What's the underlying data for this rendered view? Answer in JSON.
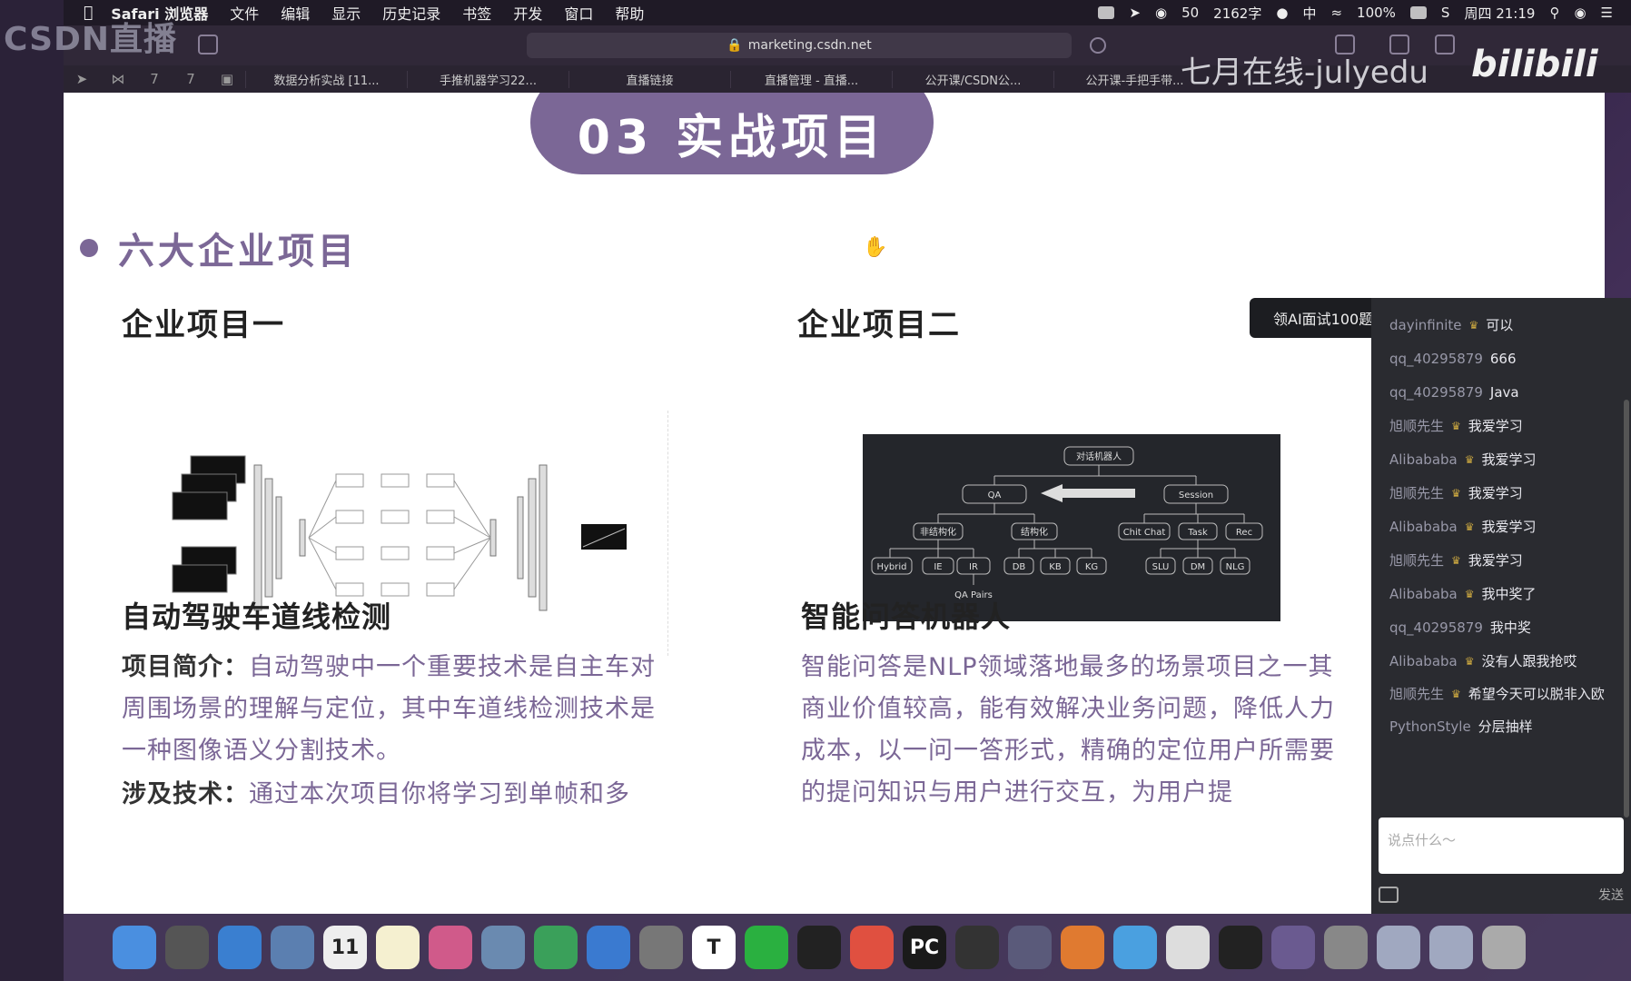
{
  "menubar": {
    "app": "Safari 浏览器",
    "items": [
      "文件",
      "编辑",
      "显示",
      "历史记录",
      "书签",
      "开发",
      "窗口",
      "帮助"
    ],
    "status": {
      "wechat_count": "50",
      "word_count": "2162字",
      "input_method": "中",
      "battery": "100%",
      "datetime": "周四 21:19"
    }
  },
  "toolbar": {
    "address": "marketing.csdn.net"
  },
  "tabs": [
    "数据分析实战 [11...",
    "手推机器学习22...",
    "直播链接",
    "直播管理 - 直播...",
    "公开课/CSDN公...",
    "公开课-手把手带..."
  ],
  "watermarks": {
    "csdn": "CSDN直播",
    "july": "七月在线-julyedu",
    "bilibili": "bilibili"
  },
  "slide": {
    "section": "03 实战项目",
    "bullet": "六大企业项目",
    "project1": {
      "heading": "企业项目一",
      "name": "自动驾驶车道线检测",
      "intro_label": "项目简介：",
      "intro_text": "自动驾驶中一个重要技术是自主车对周围场景的理解与定位，其中车道线检测技术是一种图像语义分割技术。",
      "tech_label": "涉及技术：",
      "tech_text": "通过本次项目你将学习到单帧和多"
    },
    "project2": {
      "heading": "企业项目二",
      "name": "智能问答机器人",
      "intro_text": "智能问答是NLP领域落地最多的场景项目之一其商业价值较高，能有效解决业务问题，降低人力成本，以一问一答形式，精确的定位用户所需要的提问知识与用户进行交互，为用户提"
    },
    "qa_diagram": {
      "root": "对话机器人",
      "qa": "QA",
      "session": "Session",
      "unstructured": "非结构化",
      "structured": "结构化",
      "chitchat": "Chit Chat",
      "task": "Task",
      "rec": "Rec",
      "leaves": [
        "Hybrid",
        "IE",
        "IR",
        "DB",
        "KB",
        "KG",
        "SLU",
        "DM",
        "NLG"
      ],
      "qa_pairs": "QA Pairs"
    }
  },
  "chat": {
    "promo": "领AI面试100题",
    "messages": [
      {
        "user": "dayinfinite",
        "crown": true,
        "text": "可以"
      },
      {
        "user": "qq_40295879",
        "crown": false,
        "text": "666"
      },
      {
        "user": "qq_40295879",
        "crown": false,
        "text": "Java"
      },
      {
        "user": "旭顺先生",
        "crown": true,
        "text": "我爱学习"
      },
      {
        "user": "Alibababa",
        "crown": true,
        "text": "我爱学习"
      },
      {
        "user": "旭顺先生",
        "crown": true,
        "text": "我爱学习"
      },
      {
        "user": "Alibababa",
        "crown": true,
        "text": "我爱学习"
      },
      {
        "user": "旭顺先生",
        "crown": true,
        "text": "我爱学习"
      },
      {
        "user": "Alibababa",
        "crown": true,
        "text": "我中奖了"
      },
      {
        "user": "qq_40295879",
        "crown": false,
        "text": "我中奖"
      },
      {
        "user": "Alibababa",
        "crown": true,
        "text": "没有人跟我抢哎"
      },
      {
        "user": "旭顺先生",
        "crown": true,
        "text": "希望今天可以脱非入欧"
      },
      {
        "user": "PythonStyle",
        "crown": false,
        "text": "分层抽样"
      }
    ],
    "input_placeholder": "说点什么～",
    "send": "发送"
  },
  "dock": {
    "apps": [
      "finder-icon",
      "launchpad-icon",
      "safari-icon",
      "mail-icon",
      "calendar-icon",
      "notes-icon",
      "photos-icon",
      "preview-icon",
      "numbers-icon",
      "keynote-icon",
      "settings-icon",
      "typora-icon",
      "wechat-icon",
      "qq-icon",
      "xmind-icon",
      "pycharm-icon",
      "obs-icon",
      "vmware-icon",
      "firefox-icon",
      "telegram-icon",
      "chrome-icon",
      "terminal-icon",
      "video-icon",
      "screenshot-icon",
      "folder-icon",
      "folder2-icon",
      "trash-icon"
    ],
    "calendar_day": "11",
    "typora_letter": "T",
    "pycharm_label": "PC"
  }
}
